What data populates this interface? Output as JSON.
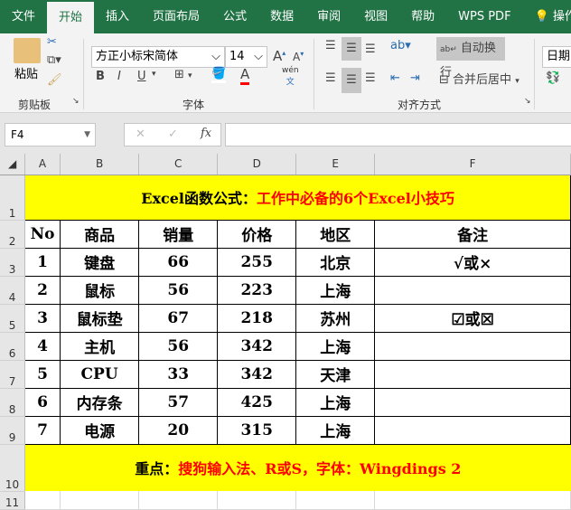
{
  "tabs": [
    "文件",
    "开始",
    "插入",
    "页面布局",
    "公式",
    "数据",
    "审阅",
    "视图",
    "帮助",
    "WPS PDF",
    "操作"
  ],
  "active_tab": "开始",
  "ribbon": {
    "clipboard": {
      "paste": "粘贴",
      "label": "剪贴板"
    },
    "font": {
      "name": "方正小标宋简体",
      "size": "14",
      "label": "字体",
      "bold": "B",
      "italic": "I",
      "underline": "U",
      "pinyin": "wén"
    },
    "alignment": {
      "wrap": "自动换行",
      "merge": "合并后居中",
      "label": "对齐方式"
    },
    "number": {
      "format": "日期"
    }
  },
  "formula_bar": {
    "name_box": "F4",
    "fx": "fx",
    "value": ""
  },
  "columns": [
    "A",
    "B",
    "C",
    "D",
    "E",
    "F"
  ],
  "rows": [
    "1",
    "2",
    "3",
    "4",
    "5",
    "6",
    "7",
    "8",
    "9",
    "10",
    "11"
  ],
  "sheet": {
    "title_black": "Excel函数公式：",
    "title_red": "工作中必备的6个Excel小技巧",
    "headers": [
      "No",
      "商品",
      "销量",
      "价格",
      "地区",
      "备注"
    ],
    "data": [
      [
        "1",
        "键盘",
        "66",
        "255",
        "北京",
        "√或×"
      ],
      [
        "2",
        "鼠标",
        "56",
        "223",
        "上海",
        ""
      ],
      [
        "3",
        "鼠标垫",
        "67",
        "218",
        "苏州",
        "☑或☒"
      ],
      [
        "4",
        "主机",
        "56",
        "342",
        "上海",
        ""
      ],
      [
        "5",
        "CPU",
        "33",
        "342",
        "天津",
        ""
      ],
      [
        "6",
        "内存条",
        "57",
        "425",
        "上海",
        ""
      ],
      [
        "7",
        "电源",
        "20",
        "315",
        "上海",
        ""
      ]
    ],
    "footer_black": "重点：",
    "footer_red": "搜狗输入法、R或S，字体：Wingdings 2"
  },
  "colors": {
    "accent": "#217346",
    "highlight": "#ffff00",
    "red": "#ff0000"
  }
}
